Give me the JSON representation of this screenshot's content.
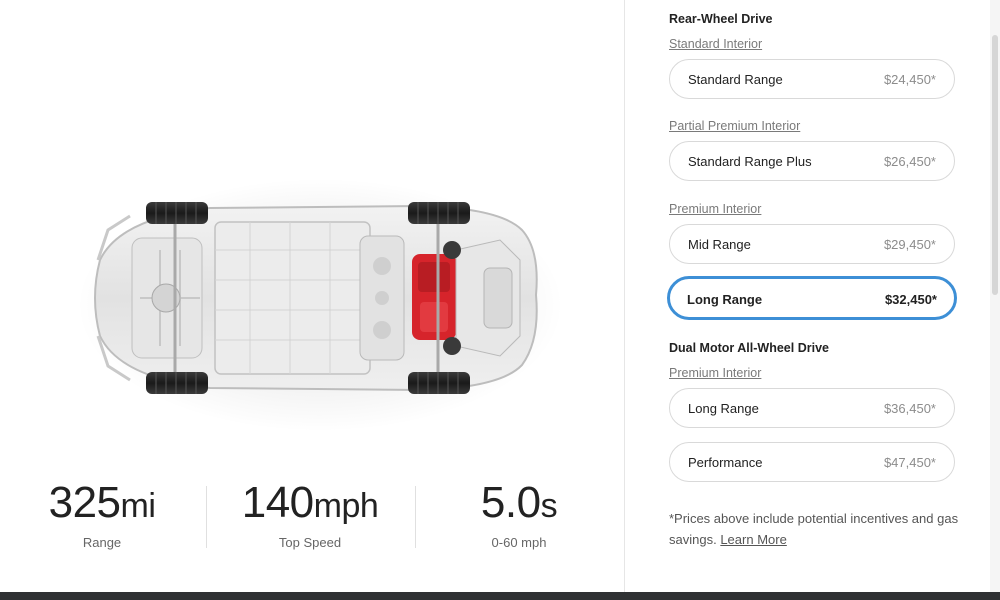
{
  "specs": [
    {
      "value": "325",
      "unit": "mi",
      "label": "Range"
    },
    {
      "value": "140",
      "unit": "mph",
      "label": "Top Speed"
    },
    {
      "value": "5.0",
      "unit": "s",
      "label": "0-60 mph"
    }
  ],
  "groups": {
    "rwd": {
      "title": "Rear-Wheel Drive"
    },
    "awd": {
      "title": "Dual Motor All-Wheel Drive"
    }
  },
  "interiors": {
    "standard": "Standard Interior",
    "partial_premium": "Partial Premium Interior",
    "premium_rwd": "Premium Interior",
    "premium_awd": "Premium Interior"
  },
  "options": [
    {
      "name": "Standard Range",
      "price": "$24,450*"
    },
    {
      "name": "Standard Range Plus",
      "price": "$26,450*"
    },
    {
      "name": "Mid Range",
      "price": "$29,450*"
    },
    {
      "name": "Long Range",
      "price": "$32,450*",
      "selected": true
    },
    {
      "name": "Long Range",
      "price": "$36,450*"
    },
    {
      "name": "Performance",
      "price": "$47,450*"
    }
  ],
  "footnote": {
    "text": "*Prices above include potential incentives and gas savings.",
    "link": "Learn More"
  },
  "colors": {
    "selected_border": "#3d8fd6",
    "motor_red": "#d6242b",
    "bottom_bar": "#2f3133"
  }
}
